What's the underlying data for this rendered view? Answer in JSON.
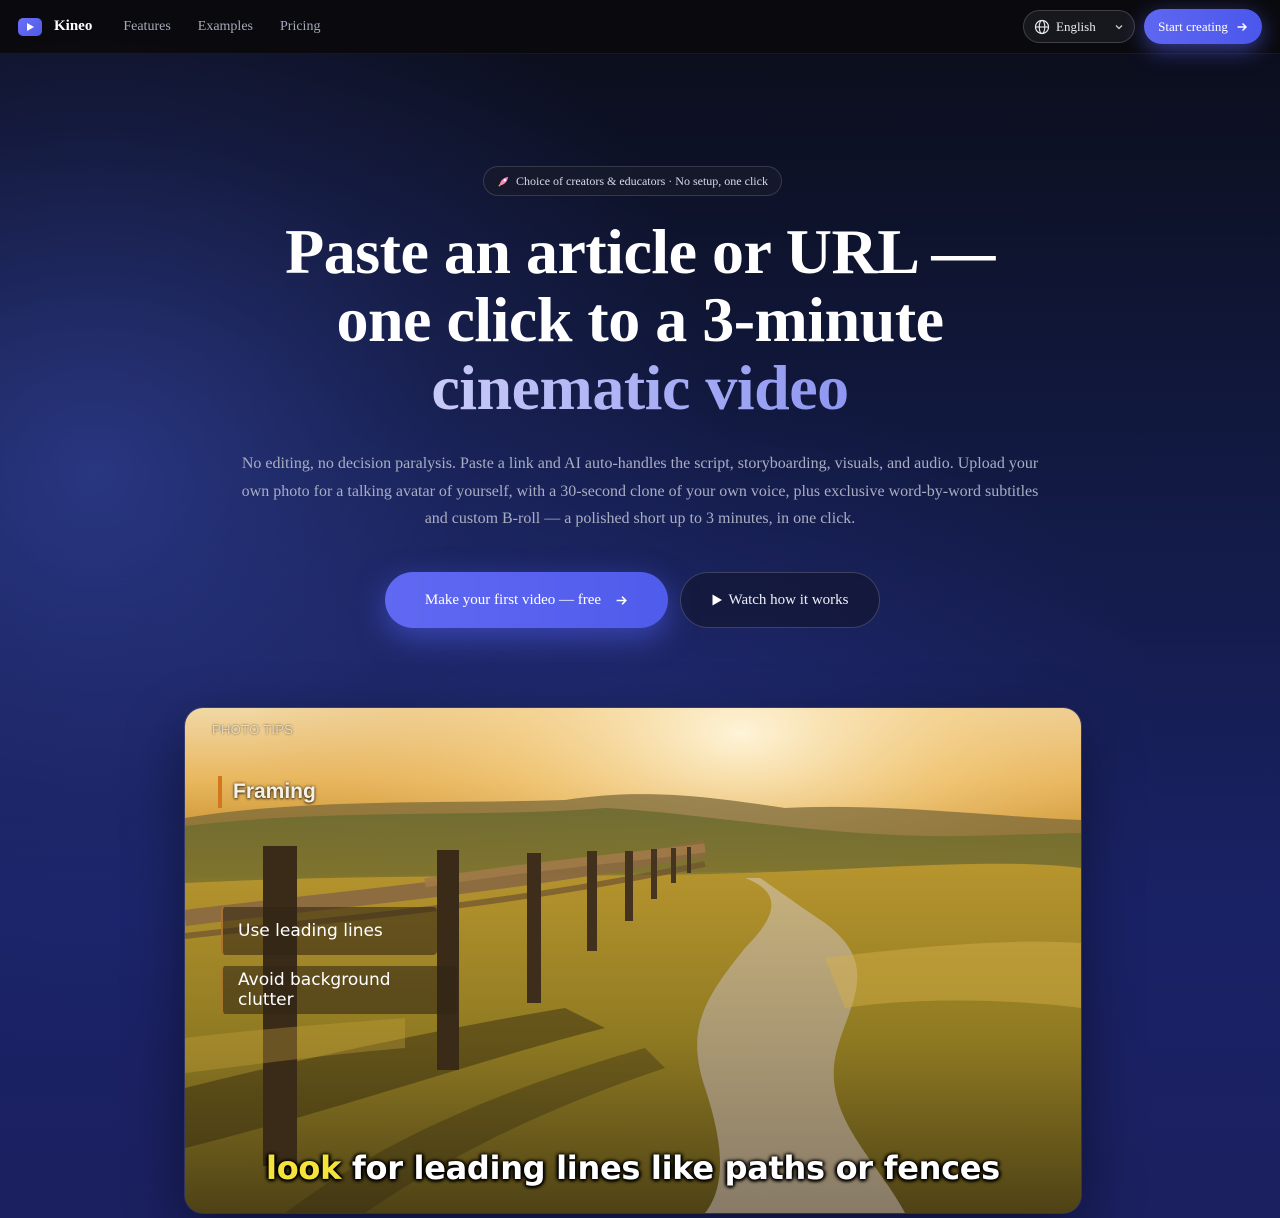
{
  "nav": {
    "brand": "Kineo",
    "links": [
      "Features",
      "Examples",
      "Pricing"
    ],
    "language": "English",
    "start_label": "Start creating"
  },
  "hero": {
    "badge_text": "Choice of creators & educators · No setup, one click",
    "headline_line1": "Paste an article or URL —",
    "headline_line2": "one click to a 3-minute",
    "headline_accent": "cinematic video",
    "subtext": "No editing, no decision paralysis. Paste a link and AI auto-handles the script, storyboarding, visuals, and audio. Upload your own photo for a talking avatar of yourself, with a 30-second clone of your own voice, plus exclusive word-by-word subtitles and custom B-roll — a polished short up to 3 minutes, in one click.",
    "cta_label": "Make your first video — free",
    "watch_label": "Watch how it works"
  },
  "video": {
    "overline": "PHOTO TIPS",
    "heading": "Framing",
    "tips": [
      "Use leading lines",
      "Avoid background clutter"
    ],
    "caption_highlight": "look",
    "caption_rest": "for leading lines like paths or fences"
  },
  "colors": {
    "accent": "#5e67f0",
    "caption_highlight": "#f5e23a",
    "framing_bar": "#d4761e"
  },
  "icons": [
    "logo-play-icon",
    "globe-icon",
    "chevron-down-icon",
    "arrow-right-icon",
    "rocket-icon",
    "play-icon"
  ]
}
